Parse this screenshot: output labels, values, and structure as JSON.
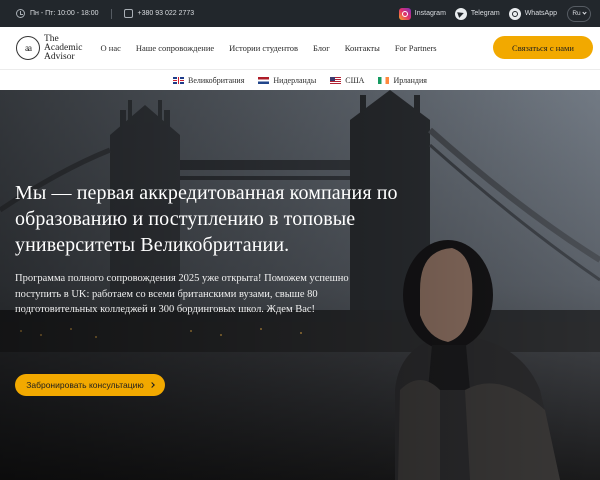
{
  "topbar": {
    "hours": "Пн - Пт: 10:00 - 18:00",
    "phone": "+380 93 022 2773",
    "instagram": "Instagram",
    "telegram": "Telegram",
    "whatsapp": "WhatsApp",
    "language": "Ru"
  },
  "header": {
    "logo_mark": "aa",
    "logo_line1": "The",
    "logo_line2": "Academic",
    "logo_line3": "Advisor",
    "nav": [
      "О нас",
      "Наше сопровождение",
      "Истории студентов",
      "Блог",
      "Контакты",
      "For Partners"
    ],
    "cta": "Связаться с нами"
  },
  "countries": [
    "Великобритания",
    "Нидерланды",
    "США",
    "Ирландия"
  ],
  "hero": {
    "title": "Мы — первая аккредитованная компания по образованию и поступлению в топовые университеты Великобритании.",
    "subtitle": "Программа полного сопровождения 2025 уже открыта! Поможем успешно поступить в UK: работаем со всеми британскими вузами, свыше 80 подготовительных колледжей и 300 бординговых школ. Ждем Вас!",
    "cta": "Забронировать консультацию"
  },
  "colors": {
    "accent": "#f2a900",
    "topbar": "#22272c"
  }
}
